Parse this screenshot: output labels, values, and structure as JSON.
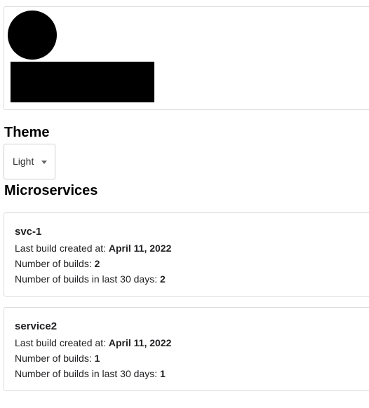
{
  "header": {
    "avatar": "redacted",
    "name": "redacted"
  },
  "theme": {
    "title": "Theme",
    "selected": "Light",
    "dropdown_icon": "caret-down-icon"
  },
  "microservices": {
    "title": "Microservices",
    "items": [
      {
        "name": "svc-1",
        "last_build_label": "Last build created at:",
        "last_build_value": "April 11, 2022",
        "builds_label": "Number of builds:",
        "builds_value": "2",
        "builds_30_label": "Number of builds in last 30 days:",
        "builds_30_value": "2"
      },
      {
        "name": "service2",
        "last_build_label": "Last build created at:",
        "last_build_value": "April 11, 2022",
        "builds_label": "Number of builds:",
        "builds_value": "1",
        "builds_30_label": "Number of builds in last 30 days:",
        "builds_30_value": "1"
      }
    ]
  }
}
